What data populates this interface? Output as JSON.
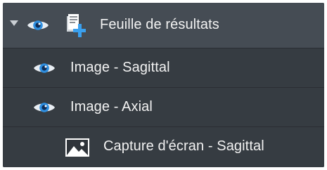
{
  "tree": {
    "root": {
      "label": "Feuille de résultats",
      "icons": [
        "caret-down-icon",
        "eye-icon",
        "results-sheet-icon"
      ]
    },
    "children": [
      {
        "label": "Image - Sagittal",
        "icon": "eye-icon"
      },
      {
        "label": "Image - Axial",
        "icon": "eye-icon"
      },
      {
        "label": "Capture d'écran - Sagittal",
        "icon": "image-icon"
      }
    ]
  },
  "colors": {
    "root_row": "#454c54",
    "child_row": "#363c42",
    "text": "#f2f2f2",
    "eye_accent": "#3fa3ea"
  }
}
